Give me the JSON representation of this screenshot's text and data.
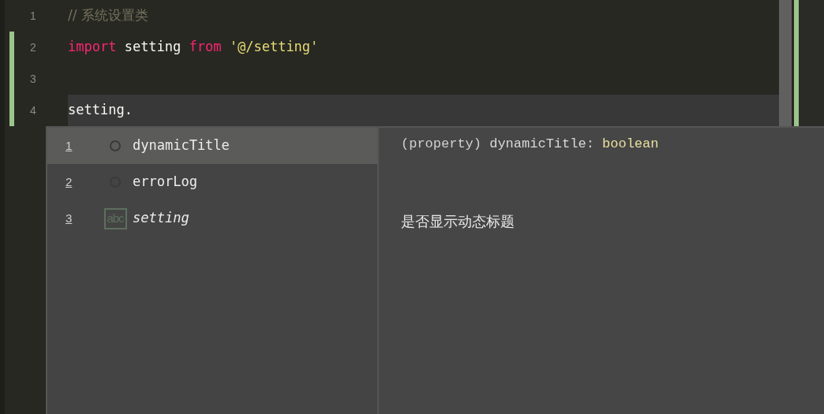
{
  "editor": {
    "lines": [
      {
        "number": "1",
        "changed": false,
        "current": false,
        "tokens": [
          {
            "kind": "comment",
            "text": "// 系统设置类"
          }
        ]
      },
      {
        "number": "2",
        "changed": true,
        "current": false,
        "tokens": [
          {
            "kind": "keyword",
            "text": "import"
          },
          {
            "kind": "plain",
            "text": " setting "
          },
          {
            "kind": "keyword",
            "text": "from"
          },
          {
            "kind": "string",
            "text": " '@/setting'"
          }
        ]
      },
      {
        "number": "3",
        "changed": true,
        "current": false
      },
      {
        "number": "4",
        "changed": true,
        "current": true,
        "tokens": [
          {
            "kind": "plain",
            "text": "setting."
          }
        ]
      }
    ]
  },
  "completion": {
    "items": [
      {
        "index": "1",
        "kind": "property",
        "label": "dynamicTitle",
        "selected": true
      },
      {
        "index": "2",
        "kind": "property",
        "label": "errorLog",
        "selected": false
      },
      {
        "index": "3",
        "kind": "text",
        "icon_text": "abc",
        "label": "setting",
        "selected": false
      }
    ],
    "detail": {
      "signature": [
        {
          "kind": "plain",
          "text": "(property) "
        },
        {
          "kind": "name",
          "text": "dynamicTitle"
        },
        {
          "kind": "plain",
          "text": ": "
        },
        {
          "kind": "type",
          "text": "boolean"
        }
      ],
      "description": "是否显示动态标题"
    }
  }
}
